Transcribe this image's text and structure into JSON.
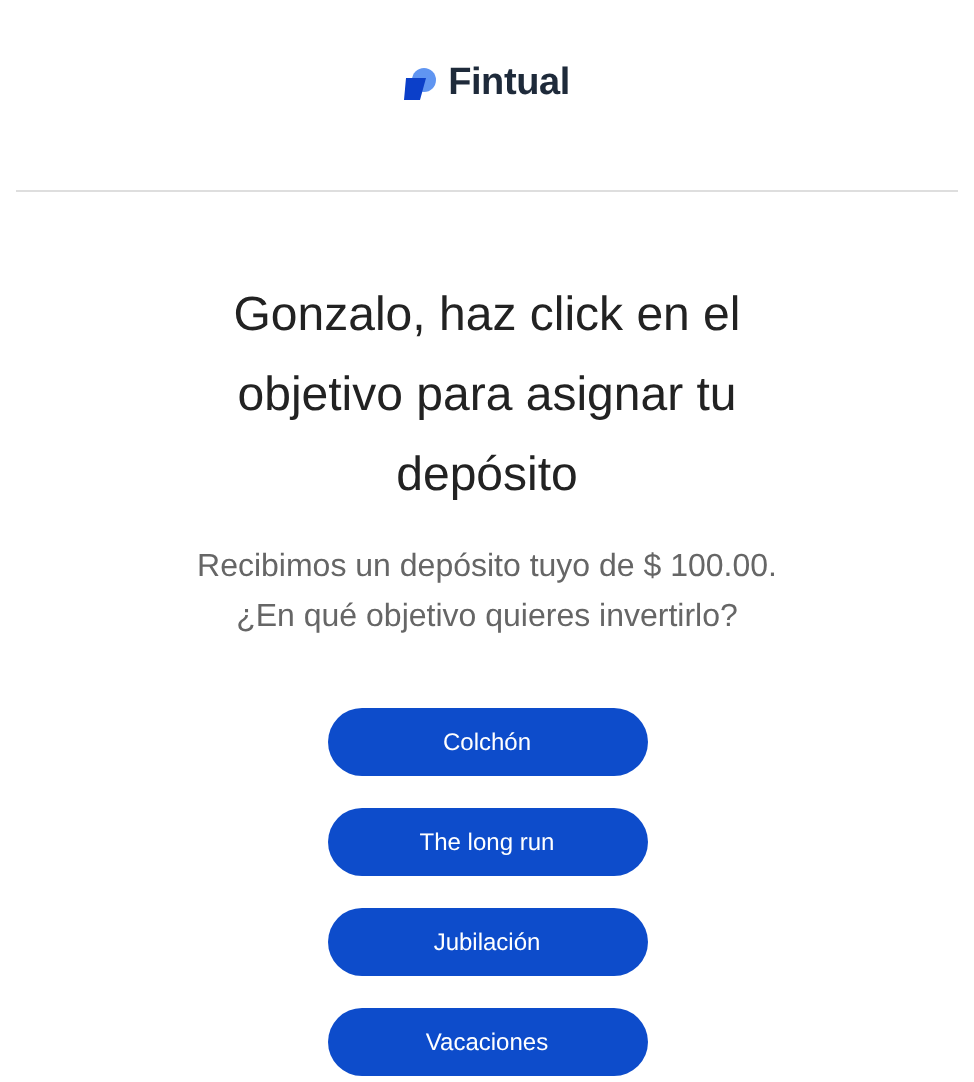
{
  "brand": {
    "name": "Fintual"
  },
  "heading": "Gonzalo, haz click en el objetivo para asignar tu depósito",
  "message": "Recibimos un depósito tuyo de $ 100.00. ¿En qué objetivo quieres invertirlo?",
  "goals": [
    {
      "label": "Colchón"
    },
    {
      "label": "The long run"
    },
    {
      "label": "Jubilación"
    },
    {
      "label": "Vacaciones"
    }
  ]
}
